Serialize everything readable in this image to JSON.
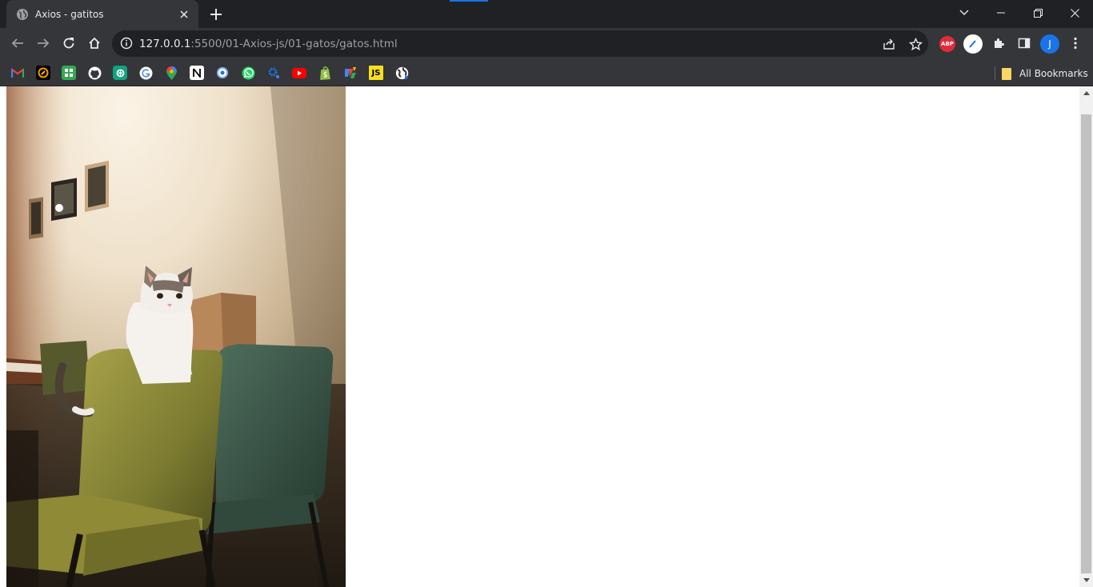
{
  "tab": {
    "title": "Axios - gatitos",
    "favicon": "globe-icon"
  },
  "toolbar": {
    "url_host": "127.0.0.1",
    "url_path": ":5500/01-Axios-js/01-gatos/gatos.html",
    "abp_label": "ABP",
    "profile_initial": "J"
  },
  "bookmarks": {
    "items": [
      {
        "name": "gmail-icon",
        "color": "#ea4335"
      },
      {
        "name": "extension-icon",
        "color": "#f29900"
      },
      {
        "name": "green-grid-icon",
        "color": "#34a853"
      },
      {
        "name": "github-icon",
        "color": "#ffffff"
      },
      {
        "name": "chatgpt-icon",
        "color": "#10a37f"
      },
      {
        "name": "google-icon",
        "color": "#4285f4"
      },
      {
        "name": "maps-icon",
        "color": "#34a853"
      },
      {
        "name": "notion-icon",
        "color": "#ffffff"
      },
      {
        "name": "target-icon",
        "color": "#8ab4f8"
      },
      {
        "name": "whatsapp-icon",
        "color": "#25d366"
      },
      {
        "name": "settings-icon",
        "color": "#1a73e8"
      },
      {
        "name": "youtube-icon",
        "color": "#ff0000"
      },
      {
        "name": "shopify-icon",
        "color": "#95bf47"
      },
      {
        "name": "colorful-icon",
        "color": "#fbbc04"
      },
      {
        "name": "js-icon",
        "color": "#f7df1e",
        "label": "JS"
      },
      {
        "name": "globe-dark-icon",
        "color": "#ffffff"
      }
    ],
    "all_label": "All Bookmarks"
  },
  "page": {
    "image": "cat-on-chair-photo"
  }
}
